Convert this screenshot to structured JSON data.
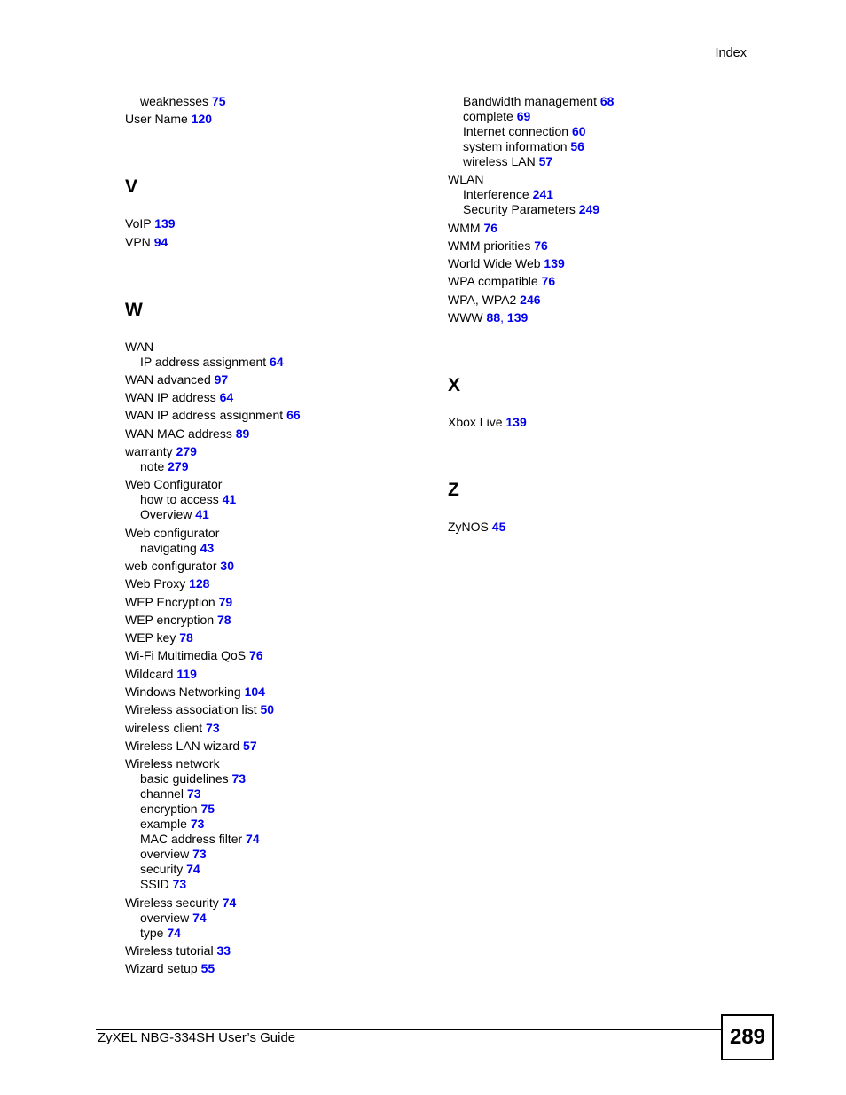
{
  "header": {
    "section_title": "Index"
  },
  "footer": {
    "guide_title": "ZyXEL NBG-334SH User’s Guide",
    "page_number": "289"
  },
  "left_column": [
    {
      "type": "sub",
      "term": "weaknesses",
      "pages": [
        "75"
      ]
    },
    {
      "type": "top",
      "term": "User Name",
      "pages": [
        "120"
      ]
    },
    {
      "type": "letter",
      "term": "V"
    },
    {
      "type": "top",
      "term": "VoIP",
      "pages": [
        "139"
      ]
    },
    {
      "type": "top",
      "term": "VPN",
      "pages": [
        "94"
      ]
    },
    {
      "type": "letter",
      "term": "W"
    },
    {
      "type": "top",
      "term": "WAN",
      "pages": []
    },
    {
      "type": "sub",
      "term": "IP address assignment",
      "pages": [
        "64"
      ]
    },
    {
      "type": "top",
      "term": "WAN advanced",
      "pages": [
        "97"
      ]
    },
    {
      "type": "top",
      "term": "WAN IP address",
      "pages": [
        "64"
      ]
    },
    {
      "type": "top",
      "term": "WAN IP address assignment",
      "pages": [
        "66"
      ]
    },
    {
      "type": "top",
      "term": "WAN MAC address",
      "pages": [
        "89"
      ]
    },
    {
      "type": "top",
      "term": "warranty",
      "pages": [
        "279"
      ]
    },
    {
      "type": "sub",
      "term": "note",
      "pages": [
        "279"
      ]
    },
    {
      "type": "top",
      "term": "Web Configurator",
      "pages": []
    },
    {
      "type": "sub",
      "term": "how to access",
      "pages": [
        "41"
      ]
    },
    {
      "type": "sub",
      "term": "Overview",
      "pages": [
        "41"
      ]
    },
    {
      "type": "top",
      "term": "Web configurator",
      "pages": []
    },
    {
      "type": "sub",
      "term": "navigating",
      "pages": [
        "43"
      ]
    },
    {
      "type": "top",
      "term": "web configurator",
      "pages": [
        "30"
      ]
    },
    {
      "type": "top",
      "term": "Web Proxy",
      "pages": [
        "128"
      ]
    },
    {
      "type": "top",
      "term": "WEP Encryption",
      "pages": [
        "79"
      ]
    },
    {
      "type": "top",
      "term": "WEP encryption",
      "pages": [
        "78"
      ]
    },
    {
      "type": "top",
      "term": "WEP key",
      "pages": [
        "78"
      ]
    },
    {
      "type": "top",
      "term": "Wi-Fi Multimedia QoS",
      "pages": [
        "76"
      ]
    },
    {
      "type": "top",
      "term": "Wildcard",
      "pages": [
        "119"
      ]
    },
    {
      "type": "top",
      "term": "Windows Networking",
      "pages": [
        "104"
      ]
    },
    {
      "type": "top",
      "term": "Wireless association list",
      "pages": [
        "50"
      ]
    },
    {
      "type": "top",
      "term": "wireless client",
      "pages": [
        "73"
      ]
    },
    {
      "type": "top",
      "term": "Wireless LAN wizard",
      "pages": [
        "57"
      ]
    },
    {
      "type": "top",
      "term": "Wireless network",
      "pages": []
    },
    {
      "type": "sub",
      "term": "basic guidelines",
      "pages": [
        "73"
      ]
    },
    {
      "type": "sub",
      "term": "channel",
      "pages": [
        "73"
      ]
    },
    {
      "type": "sub",
      "term": "encryption",
      "pages": [
        "75"
      ]
    },
    {
      "type": "sub",
      "term": "example",
      "pages": [
        "73"
      ]
    },
    {
      "type": "sub",
      "term": "MAC address filter",
      "pages": [
        "74"
      ]
    },
    {
      "type": "sub",
      "term": "overview",
      "pages": [
        "73"
      ]
    },
    {
      "type": "sub",
      "term": "security",
      "pages": [
        "74"
      ]
    },
    {
      "type": "sub",
      "term": "SSID",
      "pages": [
        "73"
      ]
    },
    {
      "type": "top",
      "term": "Wireless security",
      "pages": [
        "74"
      ]
    },
    {
      "type": "sub",
      "term": "overview",
      "pages": [
        "74"
      ]
    },
    {
      "type": "sub",
      "term": "type",
      "pages": [
        "74"
      ]
    },
    {
      "type": "top",
      "term": "Wireless tutorial",
      "pages": [
        "33"
      ]
    },
    {
      "type": "top",
      "term": "Wizard setup",
      "pages": [
        "55"
      ]
    }
  ],
  "right_column": [
    {
      "type": "sub",
      "term": "Bandwidth management",
      "pages": [
        "68"
      ]
    },
    {
      "type": "sub",
      "term": "complete",
      "pages": [
        "69"
      ]
    },
    {
      "type": "sub",
      "term": "Internet connection",
      "pages": [
        "60"
      ]
    },
    {
      "type": "sub",
      "term": "system information",
      "pages": [
        "56"
      ]
    },
    {
      "type": "sub",
      "term": "wireless LAN",
      "pages": [
        "57"
      ]
    },
    {
      "type": "top",
      "term": "WLAN",
      "pages": []
    },
    {
      "type": "sub",
      "term": "Interference",
      "pages": [
        "241"
      ]
    },
    {
      "type": "sub",
      "term": "Security Parameters",
      "pages": [
        "249"
      ]
    },
    {
      "type": "top",
      "term": "WMM",
      "pages": [
        "76"
      ]
    },
    {
      "type": "top",
      "term": "WMM priorities",
      "pages": [
        "76"
      ]
    },
    {
      "type": "top",
      "term": "World Wide Web",
      "pages": [
        "139"
      ]
    },
    {
      "type": "top",
      "term": "WPA compatible",
      "pages": [
        "76"
      ]
    },
    {
      "type": "top",
      "term": "WPA, WPA2",
      "pages": [
        "246"
      ]
    },
    {
      "type": "top",
      "term": "WWW",
      "pages": [
        "88",
        "139"
      ]
    },
    {
      "type": "letter",
      "term": "X"
    },
    {
      "type": "top",
      "term": "Xbox Live",
      "pages": [
        "139"
      ]
    },
    {
      "type": "letter",
      "term": "Z"
    },
    {
      "type": "top",
      "term": "ZyNOS",
      "pages": [
        "45"
      ]
    }
  ]
}
